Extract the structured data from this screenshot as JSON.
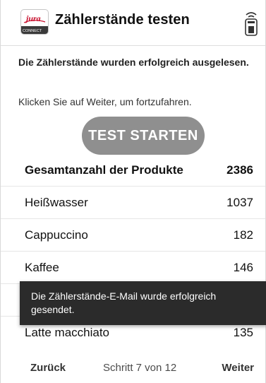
{
  "header": {
    "title": "Zählerstände testen",
    "logo_text": "jura",
    "logo_subtext": "CONNECT"
  },
  "intro_text": "Die Zählerstände wurden erfolgreich ausgelesen.",
  "instruction_text": "Klicken Sie auf Weiter, um fortzufahren.",
  "test_button_label": "TEST STARTEN",
  "rows": [
    {
      "label": "Gesamtanzahl der Produkte",
      "value": "2386",
      "total": true
    },
    {
      "label": "Heißwasser",
      "value": "1037"
    },
    {
      "label": "Cappuccino",
      "value": "182"
    },
    {
      "label": "Kaffee",
      "value": "146"
    },
    {
      "label": "",
      "value": ""
    },
    {
      "label": "Latte macchiato",
      "value": "135"
    }
  ],
  "toast_text": "Die Zählerstände-E-Mail wurde erfolgreich gesendet.",
  "footer": {
    "back_label": "Zurück",
    "step_label": "Schritt 7 von 12",
    "next_label": "Weiter"
  },
  "colors": {
    "brand_red": "#c8102e",
    "button_gray": "#8f8f8f",
    "toast_bg": "#2b2b2b"
  },
  "icons": {
    "app_logo": "jura-connect-logo",
    "device": "remote-control-signal-icon"
  }
}
